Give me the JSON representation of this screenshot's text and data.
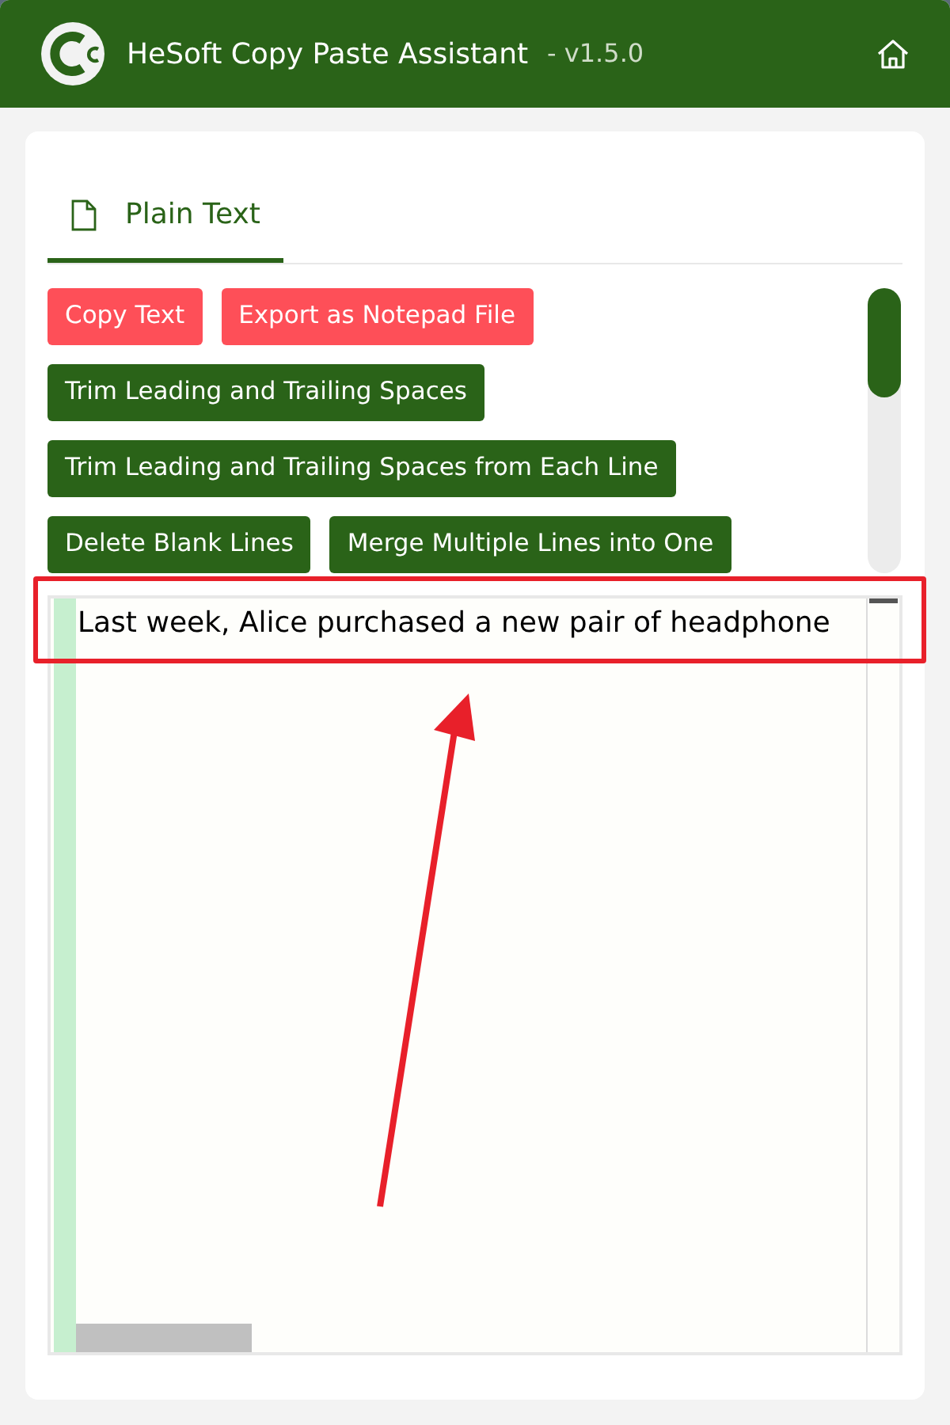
{
  "window": {
    "title": "HeSoft Copy Paste Assistant",
    "version": "- v1.5.0"
  },
  "tabs": [
    {
      "label": "Plain Text",
      "selected": true
    }
  ],
  "button_rows": [
    [
      {
        "label": "Copy Text",
        "kind": "danger"
      },
      {
        "label": "Export as Notepad File",
        "kind": "danger"
      }
    ],
    [
      {
        "label": "Trim Leading and Trailing Spaces",
        "kind": "primary"
      }
    ],
    [
      {
        "label": "Trim Leading and Trailing Spaces from Each Line",
        "kind": "primary"
      }
    ],
    [
      {
        "label": "Delete Blank Lines",
        "kind": "primary"
      },
      {
        "label": "Merge Multiple Lines into One",
        "kind": "primary"
      }
    ]
  ],
  "editor": {
    "lines": [
      "Last week, Alice purchased a new pair of headphone"
    ]
  }
}
